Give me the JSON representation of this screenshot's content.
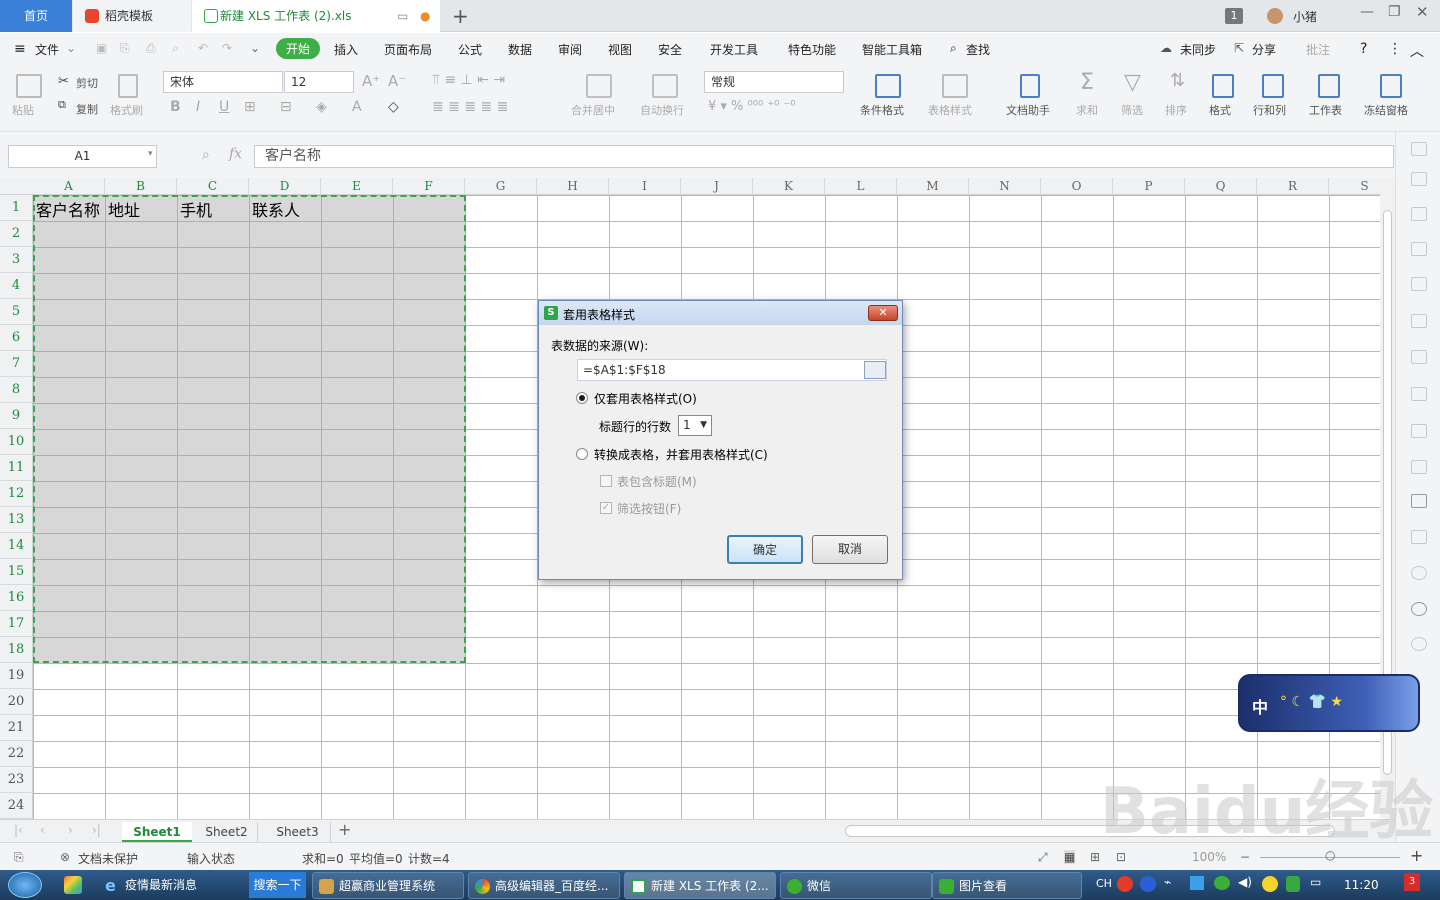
{
  "tabs": {
    "home": "首页",
    "template": "稻壳模板",
    "document": "新建 XLS 工作表 (2).xls",
    "badge": "1",
    "user": "小猪"
  },
  "menu": [
    "文件",
    "开始",
    "插入",
    "页面布局",
    "公式",
    "数据",
    "审阅",
    "视图",
    "安全",
    "开发工具",
    "特色功能",
    "智能工具箱",
    "查找"
  ],
  "menu_right": {
    "sync": "未同步",
    "share": "分享",
    "annotate": "批注",
    "help": "?"
  },
  "ribbon": {
    "paste": "粘贴",
    "cut": "剪切",
    "copy": "复制",
    "format_painter": "格式刷",
    "font_name": "宋体",
    "font_size": "12",
    "number_format": "常规",
    "merge_center": "合并居中",
    "wrap_text": "自动换行",
    "cond_format": "条件格式",
    "table_style": "表格样式",
    "doc_assistant": "文档助手",
    "sum": "求和",
    "filter": "筛选",
    "sort": "排序",
    "format": "格式",
    "row_col": "行和列",
    "worksheet": "工作表",
    "freeze": "冻结窗格"
  },
  "formula_bar": {
    "name_box": "A1",
    "fx": "fx",
    "content": "客户名称"
  },
  "columns": [
    "A",
    "B",
    "C",
    "D",
    "E",
    "F",
    "G",
    "H",
    "I",
    "J",
    "K",
    "L",
    "M",
    "N",
    "O",
    "P",
    "Q",
    "R",
    "S"
  ],
  "rows": [
    "1",
    "2",
    "3",
    "4",
    "5",
    "6",
    "7",
    "8",
    "9",
    "10",
    "11",
    "12",
    "13",
    "14",
    "15",
    "16",
    "17",
    "18",
    "19",
    "20",
    "21",
    "22",
    "23",
    "24"
  ],
  "cells_row1": [
    "客户名称",
    "地址",
    "手机",
    "联系人"
  ],
  "sheets": [
    "Sheet1",
    "Sheet2",
    "Sheet3"
  ],
  "status": {
    "protect": "文档未保护",
    "input": "输入状态",
    "sum": "求和=0",
    "avg": "平均值=0",
    "count": "计数=4",
    "zoom": "100%"
  },
  "dialog": {
    "title": "套用表格样式",
    "source_label": "表数据的来源(W):",
    "source_value": "=$A$1:$F$18",
    "opt1": "仅套用表格样式(O)",
    "header_rows_label": "标题行的行数",
    "header_rows_value": "1",
    "opt2": "转换成表格，并套用表格样式(C)",
    "chk1": "表包含标题(M)",
    "chk2": "筛选按钮(F)",
    "ok": "确定",
    "cancel": "取消"
  },
  "ime": {
    "label": "中"
  },
  "taskbar": {
    "search": "搜索一下",
    "items": [
      "疫情最新消息",
      "超赢商业管理系统",
      "高级编辑器_百度经...",
      "新建 XLS 工作表 (2...",
      "微信",
      "图片查看"
    ],
    "lang": "CH",
    "time": "11:20",
    "notif": "3"
  },
  "watermark": "Baidu经验"
}
